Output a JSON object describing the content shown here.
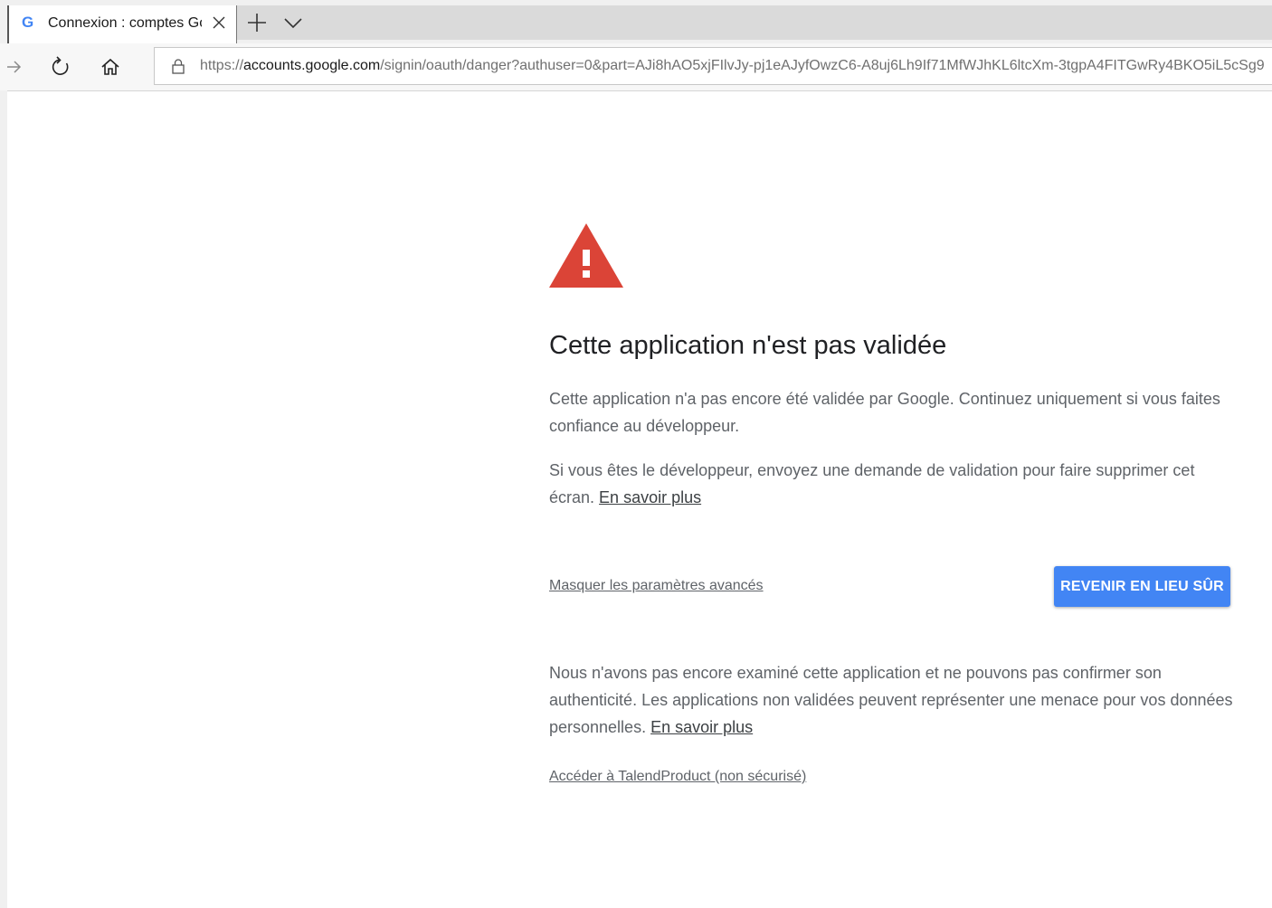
{
  "browser": {
    "tab": {
      "favicon": "google-g-icon",
      "title": "Connexion : comptes Go"
    },
    "url": {
      "scheme": "https://",
      "host": "accounts.google.com",
      "path": "/signin/oauth/danger?authuser=0&part=AJi8hAO5xjFIlvJy-pj1eAJyfOwzC6-A8uj6Lh9If71MfWJhKL6ltcXm-3tgpA4FITGwRy4BKO5iL5cSg9"
    },
    "icons": [
      "forward-icon",
      "refresh-icon",
      "home-icon",
      "lock-icon",
      "new-tab-icon",
      "tab-list-icon",
      "close-icon"
    ]
  },
  "page": {
    "title": "Cette application n'est pas validée",
    "para1": "Cette application n'a pas encore été validée par Google. Continuez uniquement si vous faites confiance au développeur.",
    "para2_text": "Si vous êtes le développeur, envoyez une demande de validation pour faire supprimer cet écran.",
    "para2_link": "En savoir plus",
    "toggle_advanced": "Masquer les paramètres avancés",
    "back_button": "REVENIR EN LIEU SÛR",
    "para3_text": "Nous n'avons pas encore examiné cette application et ne pouvons pas confirmer son authenticité. Les applications non validées peuvent représenter une menace pour vos données personnelles.",
    "para3_link": "En savoir plus",
    "proceed_link": "Accéder à TalendProduct (non sécurisé)"
  },
  "colors": {
    "warning_red": "#db4437",
    "button_blue": "#4285f4"
  }
}
